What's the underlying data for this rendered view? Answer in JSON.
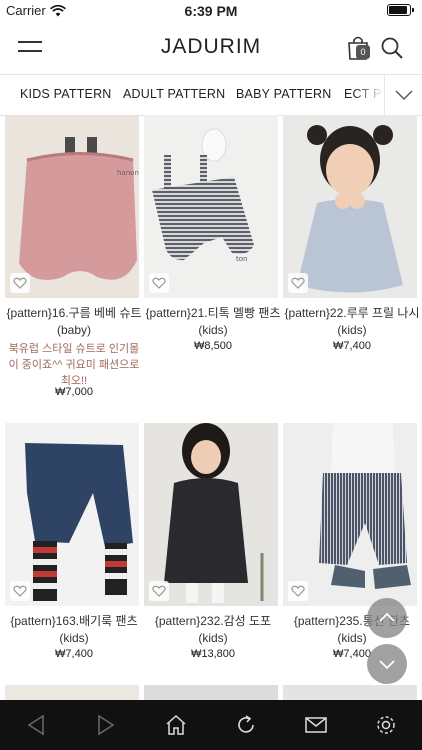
{
  "status": {
    "carrier": "Carrier",
    "time": "6:39 PM"
  },
  "header": {
    "logo": "JADURIM",
    "cart_count": "0"
  },
  "tabs": [
    "KIDS PATTERN",
    "ADULT PATTERN",
    "BABY PATTERN",
    "ECT P"
  ],
  "products": [
    {
      "name": "{pattern}16.구름 베베 슈트",
      "category": "(baby)",
      "desc": "북유럽 스타일 슈트로 인기몰이 중이죠^^ 귀요미 패션으로 최오!!",
      "price": "₩7,000"
    },
    {
      "name": "{pattern}21.티톡 멜빵 팬츠",
      "category": "(kids)",
      "desc": "",
      "price": "₩8,500"
    },
    {
      "name": "{pattern}22.루루 프릴 나시",
      "category": "(kids)",
      "desc": "",
      "price": "₩7,400"
    },
    {
      "name": "{pattern}163.배기룩 팬츠",
      "category": "(kids)",
      "desc": "",
      "price": "₩7,400"
    },
    {
      "name": "{pattern}232.감성 도포",
      "category": "(kids)",
      "desc": "",
      "price": "₩13,800"
    },
    {
      "name": "{pattern}235.통신 한츠",
      "category": "(kids)",
      "desc": "",
      "price": "₩7,400"
    }
  ],
  "icons": {
    "menu": "hamburger-icon",
    "cart": "shopping-bag-icon",
    "search": "search-icon",
    "tab_more": "chevron-down-icon",
    "wishlist": "heart-icon",
    "scroll_up": "chevron-up-icon",
    "scroll_down": "chevron-down-icon",
    "nav": [
      "back-arrow-icon",
      "forward-arrow-icon",
      "home-icon",
      "refresh-icon",
      "mail-icon",
      "settings-icon"
    ]
  }
}
